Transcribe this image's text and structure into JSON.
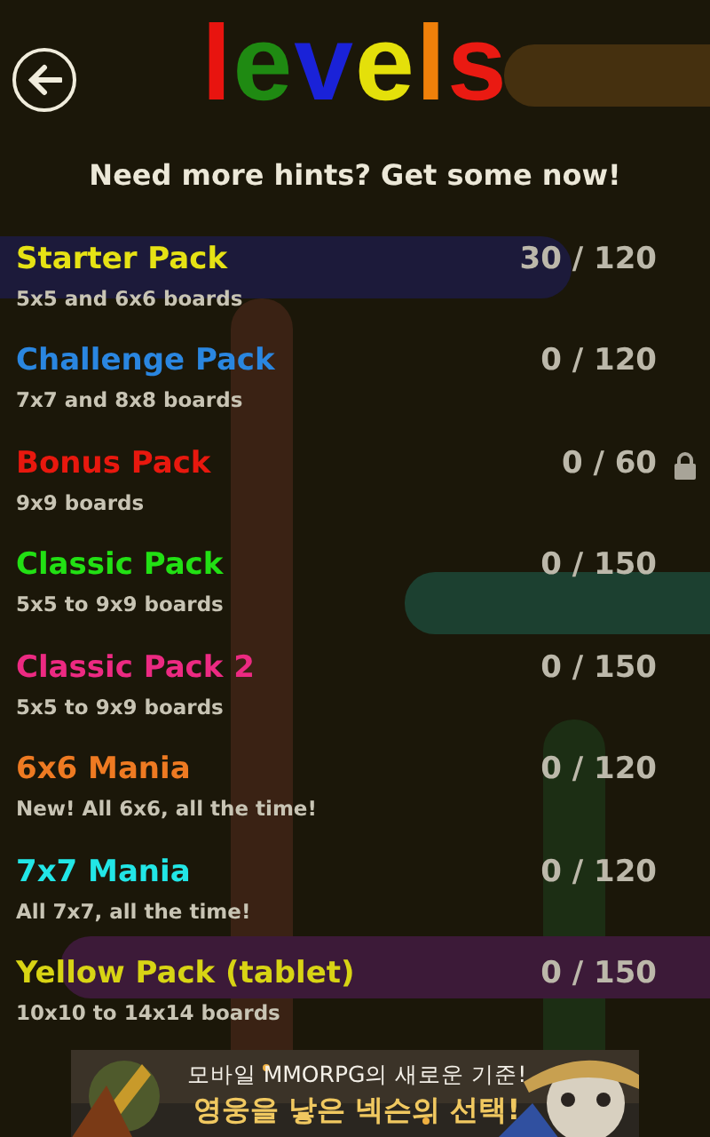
{
  "title": {
    "letters": [
      {
        "text": "l",
        "color": "#e8140f"
      },
      {
        "text": "e",
        "color": "#1f8a12"
      },
      {
        "text": "v",
        "color": "#1a22d8"
      },
      {
        "text": "e",
        "color": "#e4e00a"
      },
      {
        "text": "l",
        "color": "#ef800a"
      },
      {
        "text": "s",
        "color": "#ea1a12"
      }
    ]
  },
  "hint": "Need more hints? Get some now!",
  "packs": [
    {
      "name": "Starter Pack",
      "color": "#e6e214",
      "description": "5x5 and 6x6 boards",
      "progress": "30 / 120",
      "locked": false
    },
    {
      "name": "Challenge Pack",
      "color": "#2a86e0",
      "description": "7x7 and 8x8 boards",
      "progress": "0 / 120",
      "locked": false
    },
    {
      "name": "Bonus Pack",
      "color": "#e8180e",
      "description": "9x9 boards",
      "progress": "0 / 60",
      "locked": true
    },
    {
      "name": "Classic Pack",
      "color": "#22e014",
      "description": "5x5 to 9x9 boards",
      "progress": "0 / 150",
      "locked": false
    },
    {
      "name": "Classic Pack 2",
      "color": "#ec2a82",
      "description": "5x5 to 9x9 boards",
      "progress": "0 / 150",
      "locked": false
    },
    {
      "name": "6x6 Mania",
      "color": "#ee7a22",
      "description": "New! All 6x6, all the time!",
      "progress": "0 / 120",
      "locked": false
    },
    {
      "name": "7x7 Mania",
      "color": "#22e6e6",
      "description": "All 7x7, all the time!",
      "progress": "0 / 120",
      "locked": false
    },
    {
      "name": "Yellow Pack (tablet)",
      "color": "#d8d414",
      "description": "10x10 to 14x14 boards",
      "progress": "0 / 150",
      "locked": false
    }
  ],
  "ad": {
    "kind": "picture",
    "line_1": "모바일 MMORPG의 새로운 기준!",
    "line_2": "영웅을 낳은 넥슨의 선택!"
  }
}
